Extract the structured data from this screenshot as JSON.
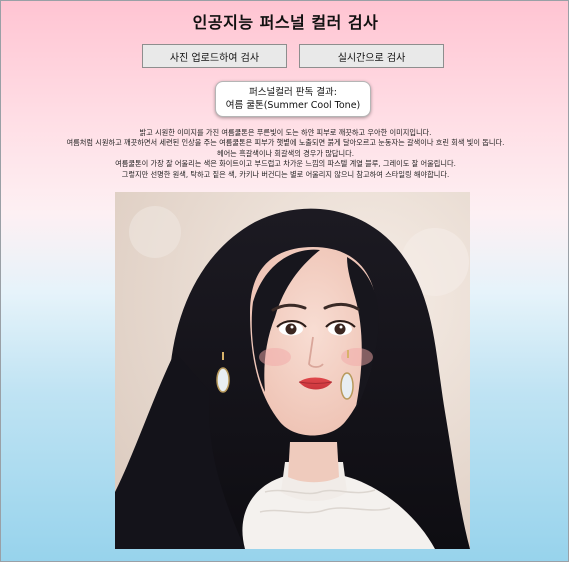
{
  "header": {
    "title": "인공지능 퍼스널 컬러 검사"
  },
  "buttons": {
    "upload_label": "사진 업로드하여 검사",
    "live_label": "실시간으로 검사"
  },
  "result": {
    "heading": "퍼스널컬러 판독 결과:",
    "value": "여름 쿨톤(Summer Cool Tone)"
  },
  "description": {
    "lines": [
      "밝고 시원한 이미지를 가진 여름쿨톤은 푸른빛이 도는 하얀 피부로 깨끗하고 우아한 이미지입니다.",
      "여름처럼 시원하고 깨끗하면서 세련된 인상을 주는 여름쿨톤은 피부가 햇볕에 노출되면 붉게 달아오르고 눈동자는 갈색이나 흐린 회색 빛이 돕니다.",
      "헤어는 흑갈색이나 회갈색의 경우가 많답니다.",
      "여름쿨톤이 가장 잘 어울리는 색은 화이트이고 부드럽고 차가운 느낌의 파스텔 계열 블루, 그레이도 잘 어울립니다.",
      "그렇지만 선명한 원색, 탁하고 짙은 색, 카키나 버건디는 별로 어울리지 않으니 참고하여 스타일링 해야합니다."
    ]
  }
}
